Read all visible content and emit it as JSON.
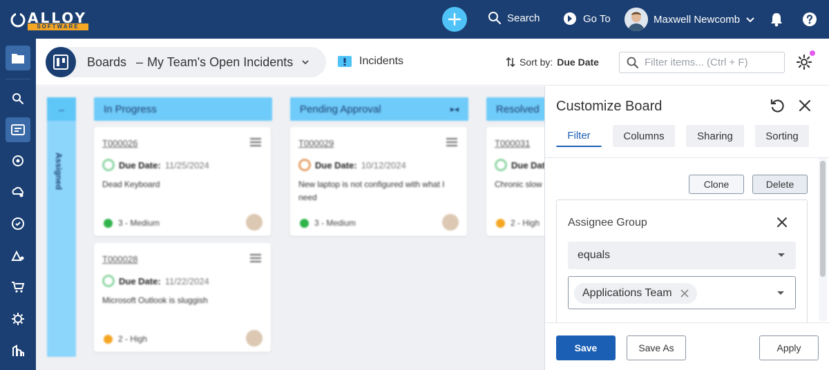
{
  "app": {
    "logo_word": "ALLOY",
    "logo_sub": "SOFTWARE"
  },
  "topbar": {
    "search_label": "Search",
    "goto_label": "Go To",
    "user_name": "Maxwell Newcomb"
  },
  "header": {
    "board_label": "Boards",
    "separator": "–",
    "board_name": "My Team's Open Incidents",
    "object_type": "Incidents",
    "sort_prefix": "Sort by:",
    "sort_value": "Due Date",
    "filter_placeholder": "Filter items... (Ctrl + F)"
  },
  "board": {
    "assigned_label": "Assigned",
    "columns": [
      {
        "name": "In Progress"
      },
      {
        "name": "Pending Approval"
      },
      {
        "name": "Resolved"
      }
    ],
    "cards": [
      {
        "id": "T000026",
        "due_label": "Due Date:",
        "due_date": "11/25/2024",
        "desc": "Dead Keyboard",
        "priority": "3 - Medium",
        "prio_color": "#2fb34a"
      },
      {
        "id": "T000028",
        "due_label": "Due Date:",
        "due_date": "11/22/2024",
        "desc": "Microsoft Outlook is sluggish",
        "priority": "2 - High",
        "prio_color": "#f5a623"
      },
      {
        "id": "T000029",
        "due_label": "Due Date:",
        "due_date": "10/12/2024",
        "desc": "New laptop is not configured with what I need",
        "priority": "3 - Medium",
        "prio_color": "#2fb34a"
      },
      {
        "id": "T000031",
        "due_label": "Due Date:",
        "due_date": "",
        "desc": "Chronic slow",
        "priority": "2 - High",
        "prio_color": "#f5a623"
      }
    ]
  },
  "panel": {
    "title": "Customize Board",
    "tabs": [
      {
        "label": "Filter"
      },
      {
        "label": "Columns"
      },
      {
        "label": "Sharing"
      },
      {
        "label": "Sorting"
      }
    ],
    "clone_label": "Clone",
    "delete_label": "Delete",
    "criterion": {
      "field": "Assignee Group",
      "operator": "equals",
      "value": "Applications Team"
    },
    "save_label": "Save",
    "save_as_label": "Save As",
    "apply_label": "Apply"
  },
  "colors": {
    "navy": "#1b3f72",
    "accent": "#4fc3f7",
    "primary_button": "#1b5fb5"
  }
}
